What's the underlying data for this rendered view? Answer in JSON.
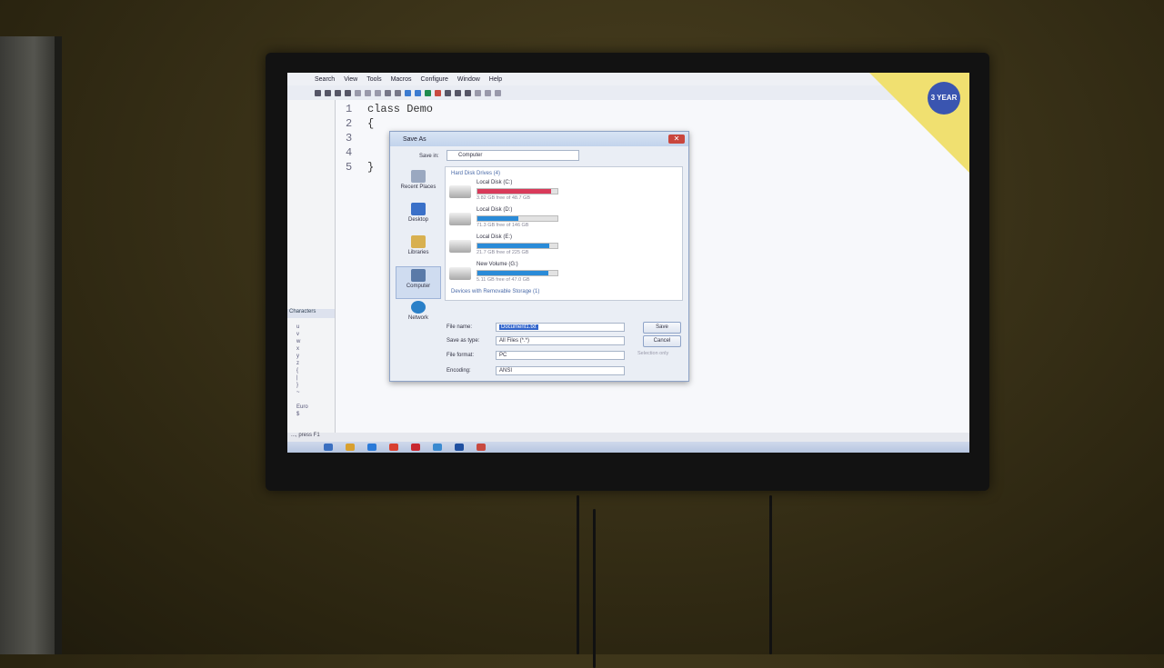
{
  "app": {
    "menu": [
      "Search",
      "View",
      "Tools",
      "Macros",
      "Configure",
      "Window",
      "Help"
    ],
    "code_lines": [
      {
        "num": "1",
        "text": "class Demo"
      },
      {
        "num": "2",
        "text": "{"
      },
      {
        "num": "3",
        "text": ""
      },
      {
        "num": "4",
        "text": ""
      },
      {
        "num": "5",
        "text": "}"
      }
    ],
    "char_panel_title": "Characters",
    "status_text": "..., press F1",
    "sticker_text": "3 YEAR"
  },
  "dialog": {
    "title": "Save As",
    "close_label": "✕",
    "save_in_label": "Save in:",
    "save_in_value": "Computer",
    "places": [
      {
        "label": "Recent Places",
        "icon": "recent-places-icon"
      },
      {
        "label": "Desktop",
        "icon": "desktop-icon"
      },
      {
        "label": "Libraries",
        "icon": "libraries-icon"
      },
      {
        "label": "Computer",
        "icon": "computer-icon"
      },
      {
        "label": "Network",
        "icon": "network-icon"
      }
    ],
    "hard_disk_header": "Hard Disk Drives (4)",
    "drives": [
      {
        "name": "Local Disk (C:)",
        "free": "3.82 GB free of 48.7 GB",
        "used_fraction": 0.92,
        "color": "#d93a5a"
      },
      {
        "name": "Local Disk (D:)",
        "free": "71.3 GB free of 146 GB",
        "used_fraction": 0.51,
        "color": "#2a8bd8"
      },
      {
        "name": "Local Disk (E:)",
        "free": "21.7 GB free of 225 GB",
        "used_fraction": 0.9,
        "color": "#2a8bd8"
      },
      {
        "name": "New Volume (G:)",
        "free": "5.11 GB free of 47.0 GB",
        "used_fraction": 0.89,
        "color": "#2a8bd8"
      }
    ],
    "removable_header": "Devices with Removable Storage (1)",
    "file_name_label": "File name:",
    "file_name_value": "Document1.txt",
    "save_type_label": "Save as type:",
    "save_type_value": "All Files (*.*)",
    "file_format_label": "File format:",
    "file_format_value": "PC",
    "encoding_label": "Encoding:",
    "encoding_value": "ANSI",
    "save_button": "Save",
    "cancel_button": "Cancel",
    "selection_only": "Selection only"
  }
}
